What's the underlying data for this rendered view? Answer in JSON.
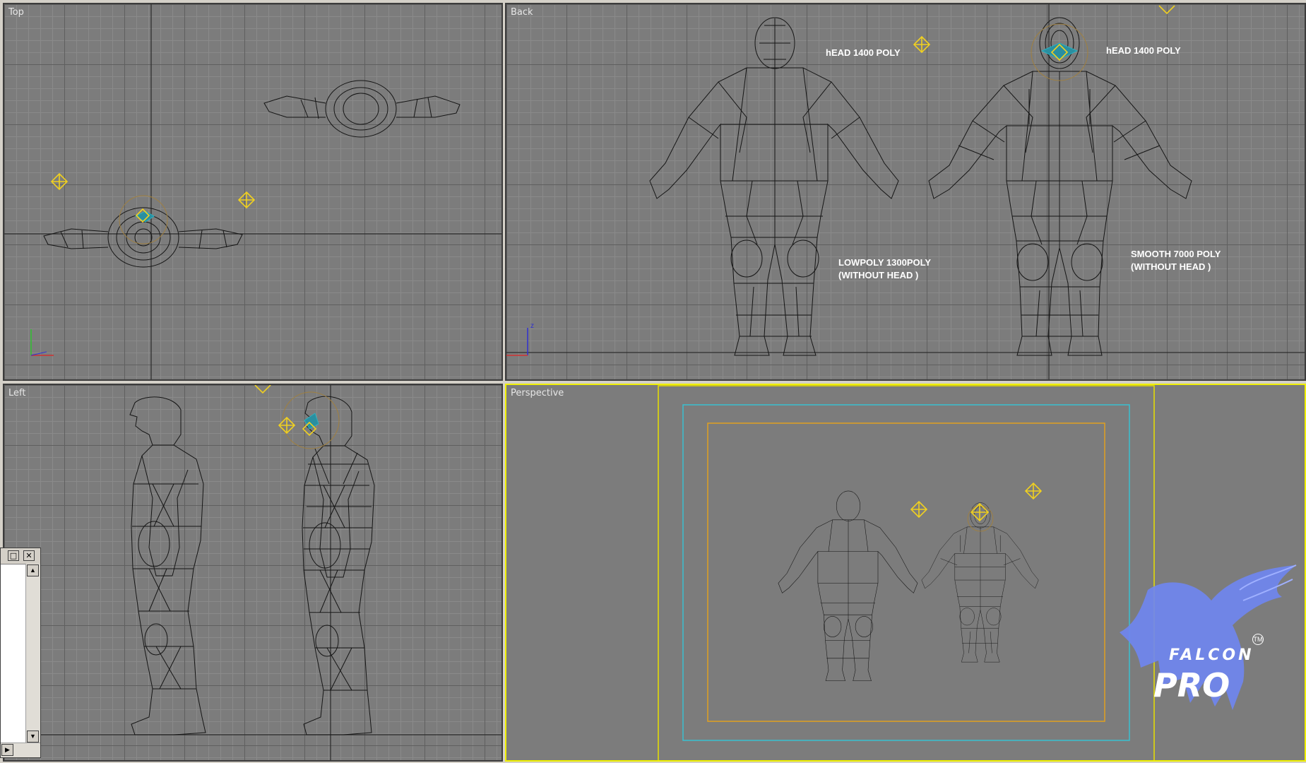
{
  "viewports": {
    "top": {
      "label": "Top"
    },
    "back": {
      "label": "Back"
    },
    "left": {
      "label": "Left"
    },
    "perspective": {
      "label": "Perspective"
    }
  },
  "annotations": {
    "head_poly_left": "hEAD 1400 POLY",
    "head_poly_right": "hEAD 1400 POLY",
    "lowpoly": "LOWPOLY 1300POLY\n(WITHOUT HEAD )",
    "smooth": "SMOOTH 7000 POLY\n(WITHOUT HEAD )"
  },
  "axes": {
    "x": "x",
    "y": "y",
    "z": "z"
  },
  "logo": {
    "line1": "FALCON",
    "line2": "PRO",
    "tm": "TM"
  },
  "mini_window": {
    "restore_glyph": "□",
    "close_glyph": "✕",
    "scroll_up": "▲",
    "scroll_down": "▼",
    "scroll_right": "▶"
  },
  "colors": {
    "viewport_bg": "#7c7c7c",
    "active_border": "#f0f000",
    "wire": "#151515",
    "helper": "#f0d020",
    "safe_frame_outer": "#e8e000",
    "safe_frame_action": "#3ac0d0",
    "safe_frame_title": "#e0a020",
    "logo_blue": "#6f86f2"
  }
}
